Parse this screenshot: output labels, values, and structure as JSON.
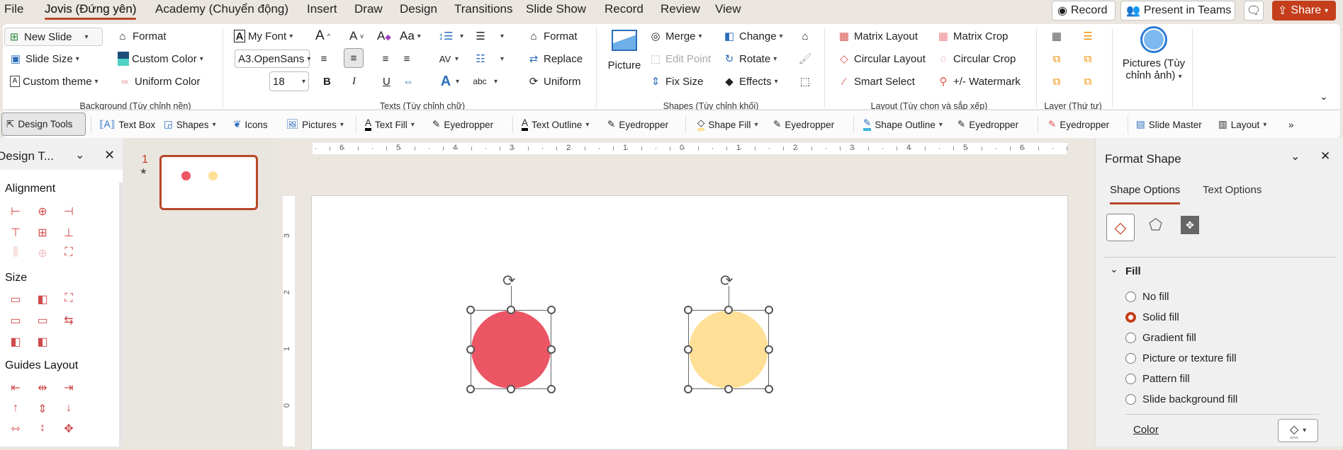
{
  "tabs": [
    "File",
    "Jovis (Đứng yên)",
    "Academy (Chuyển động)",
    "Insert",
    "Draw",
    "Design",
    "Transitions",
    "Slide Show",
    "Record",
    "Review",
    "View"
  ],
  "active_tab": "Jovis (Đứng yên)",
  "top_buttons": {
    "record": "Record",
    "present": "Present in Teams",
    "share": "Share"
  },
  "ribbon": {
    "background": {
      "new_slide": "New Slide",
      "slide_size": "Slide Size",
      "custom_theme": "Custom theme",
      "format": "Format",
      "custom_color": "Custom Color",
      "uniform_color": "Uniform Color",
      "label": "Background (Tùy chỉnh nền)"
    },
    "texts": {
      "my_font": "My Font",
      "font_name": "A3.OpenSans",
      "font_size": "18",
      "bold": "B",
      "italic": "I",
      "underline": "U",
      "format": "Format",
      "replace": "Replace",
      "uniform": "Uniform",
      "label": "Texts (Tùy chỉnh chữ)"
    },
    "shapes": {
      "picture": "Picture",
      "merge": "Merge",
      "edit_point": "Edit Point",
      "fix_size": "Fix Size",
      "change": "Change",
      "rotate": "Rotate",
      "effects": "Effects",
      "label": "Shapes (Tùy chỉnh khối)"
    },
    "layout": {
      "matrix_layout": "Matrix Layout",
      "circular_layout": "Circular Layout",
      "smart_select": "Smart Select",
      "matrix_crop": "Matrix Crop",
      "circular_crop": "Circular Crop",
      "watermark": "+/- Watermark",
      "label": "Layout (Tùy chọn và sắp xếp)"
    },
    "layer": {
      "label": "Layer (Thứ tự)"
    },
    "pictures": {
      "line1": "Pictures (Tùy",
      "line2": "chỉnh ảnh)"
    }
  },
  "toolbar": {
    "design_tools": "Design Tools",
    "text_box": "Text Box",
    "shapes": "Shapes",
    "icons": "Icons",
    "pictures": "Pictures",
    "text_fill": "Text Fill",
    "eyedropper": "Eyedropper",
    "text_outline": "Text Outline",
    "shape_fill": "Shape Fill",
    "shape_outline": "Shape Outline",
    "slide_master": "Slide Master",
    "layout": "Layout",
    "more": "»"
  },
  "left_pane": {
    "title": "Design T...",
    "alignment": "Alignment",
    "size": "Size",
    "guides": "Guides Layout"
  },
  "thumbnails": [
    {
      "number": "1"
    }
  ],
  "ruler": {
    "h": [
      "6",
      "5",
      "4",
      "3",
      "2",
      "1",
      "0",
      "1",
      "2",
      "3",
      "4",
      "5",
      "6"
    ],
    "v": [
      "3",
      "2",
      "1",
      "0"
    ]
  },
  "shapes": [
    {
      "name": "red-circle",
      "color": "#ec5564"
    },
    {
      "name": "yellow-circle",
      "color": "#ffe096"
    }
  ],
  "format_pane": {
    "title": "Format Shape",
    "tabs": [
      "Shape Options",
      "Text Options"
    ],
    "section": "Fill",
    "options": [
      {
        "label": "No fill",
        "checked": false
      },
      {
        "label": "Solid fill",
        "checked": true
      },
      {
        "label": "Gradient fill",
        "checked": false
      },
      {
        "label": "Picture or texture fill",
        "checked": false
      },
      {
        "label": "Pattern fill",
        "checked": false
      },
      {
        "label": "Slide background fill",
        "checked": false
      }
    ],
    "color_label": "Color"
  },
  "colors": {
    "accent": "#b7472a",
    "share": "#c43e1c"
  }
}
